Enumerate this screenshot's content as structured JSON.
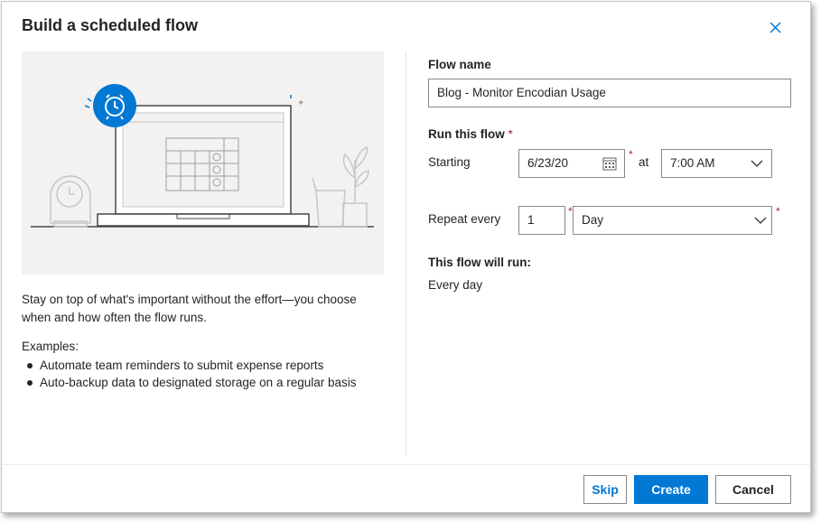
{
  "dialog": {
    "title": "Build a scheduled flow"
  },
  "left": {
    "description": "Stay on top of what's important without the effort—you choose when and how often the flow runs.",
    "examples_title": "Examples:",
    "examples": [
      "Automate team reminders to submit expense reports",
      "Auto-backup data to designated storage on a regular basis"
    ]
  },
  "form": {
    "flow_name_label": "Flow name",
    "flow_name_value": "Blog - Monitor Encodian Usage",
    "run_label": "Run this flow",
    "required_mark": "*",
    "starting_label": "Starting",
    "start_date": "6/23/20",
    "at_label": "at",
    "start_time": "7:00 AM",
    "repeat_label": "Repeat every",
    "repeat_interval": "1",
    "repeat_unit": "Day",
    "will_run_label": "This flow will run:",
    "will_run_value": "Every day"
  },
  "footer": {
    "skip_label": "Skip",
    "create_label": "Create",
    "cancel_label": "Cancel"
  },
  "icons": {
    "close": "close-icon",
    "calendar": "calendar-icon",
    "chevron": "chevron-down-icon",
    "alarm": "alarm-clock-icon"
  },
  "colors": {
    "accent": "#0078d4",
    "required": "#a4262c",
    "illustration_bg": "#f3f2f1"
  }
}
